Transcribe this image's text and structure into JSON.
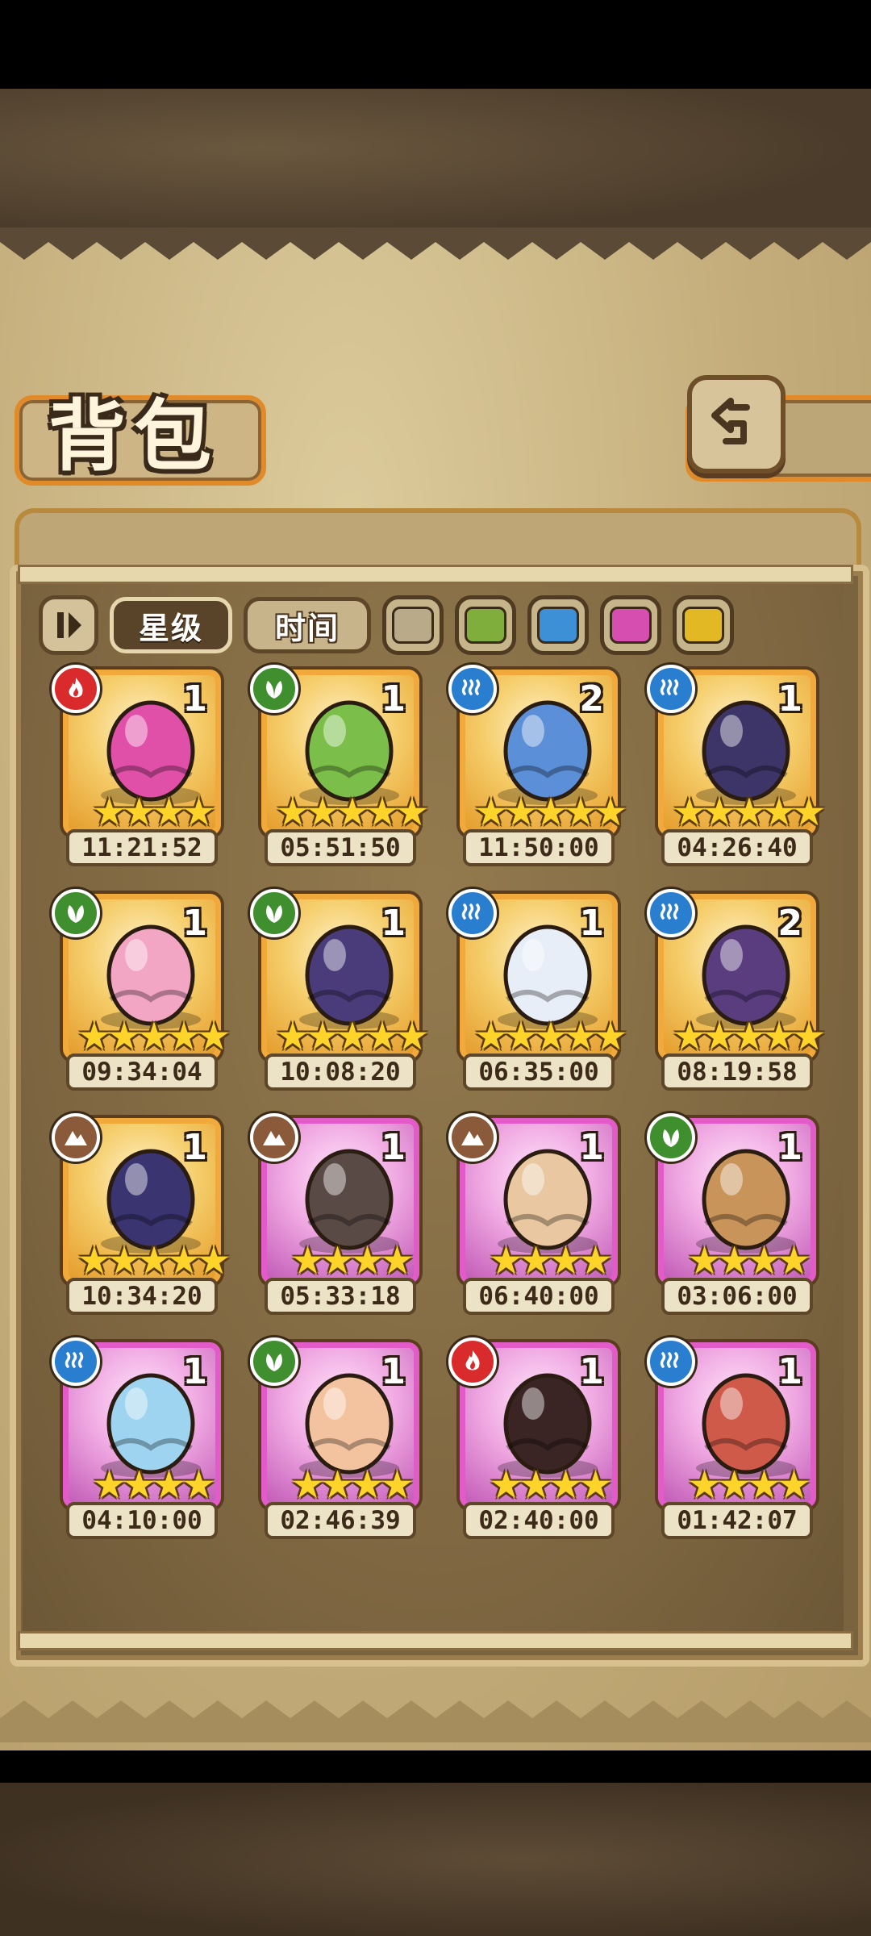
{
  "header": {
    "title": "背包"
  },
  "sort": {
    "star_label": "星级",
    "time_label": "时间"
  },
  "filters": [
    "#b9ab8a",
    "#7fae3c",
    "#3d8fd6",
    "#d64fb0",
    "#e2b825"
  ],
  "element_colors": {
    "fire": "#d92b2b",
    "grass": "#3f8f2e",
    "water": "#2a7ed0",
    "earth": "#8a5a3a"
  },
  "items": [
    {
      "name": "pink-vortex-egg",
      "element": "fire",
      "count": "1",
      "stars": 4,
      "rarity": "gold",
      "timer": "11:21:52",
      "art": "#e04fa8"
    },
    {
      "name": "green-lantern-egg",
      "element": "grass",
      "count": "1",
      "stars": 5,
      "rarity": "gold",
      "timer": "05:51:50",
      "art": "#7bbf4a"
    },
    {
      "name": "blue-shark-egg",
      "element": "water",
      "count": "2",
      "stars": 5,
      "rarity": "gold",
      "timer": "11:50:00",
      "art": "#5b8fd8"
    },
    {
      "name": "dark-feather-egg",
      "element": "water",
      "count": "1",
      "stars": 5,
      "rarity": "gold",
      "timer": "04:26:40",
      "art": "#3d3568"
    },
    {
      "name": "pink-fox-egg",
      "element": "grass",
      "count": "1",
      "stars": 5,
      "rarity": "gold",
      "timer": "09:34:04",
      "art": "#f3a6c4"
    },
    {
      "name": "purple-rune-egg",
      "element": "grass",
      "count": "1",
      "stars": 5,
      "rarity": "gold",
      "timer": "10:08:20",
      "art": "#4a3c7a"
    },
    {
      "name": "pearl-wing-egg",
      "element": "water",
      "count": "1",
      "stars": 5,
      "rarity": "gold",
      "timer": "06:35:00",
      "art": "#e8eef7"
    },
    {
      "name": "clock-egg",
      "element": "water",
      "count": "2",
      "stars": 5,
      "rarity": "gold",
      "timer": "08:19:58",
      "art": "#5a3d7e"
    },
    {
      "name": "crystal-rock-egg",
      "element": "earth",
      "count": "1",
      "stars": 5,
      "rarity": "gold",
      "timer": "10:34:20",
      "art": "#3a3470"
    },
    {
      "name": "bowtie-egg",
      "element": "earth",
      "count": "1",
      "stars": 4,
      "rarity": "purple",
      "timer": "05:33:18",
      "art": "#5a4a46"
    },
    {
      "name": "vine-nest-egg",
      "element": "earth",
      "count": "1",
      "stars": 4,
      "rarity": "purple",
      "timer": "06:40:00",
      "art": "#e9c7a0"
    },
    {
      "name": "tiger-egg",
      "element": "grass",
      "count": "1",
      "stars": 4,
      "rarity": "purple",
      "timer": "03:06:00",
      "art": "#c9945a"
    },
    {
      "name": "slime-cat-egg",
      "element": "water",
      "count": "1",
      "stars": 4,
      "rarity": "purple",
      "timer": "04:10:00",
      "art": "#9ed4ef"
    },
    {
      "name": "feather-nest-egg",
      "element": "grass",
      "count": "1",
      "stars": 4,
      "rarity": "purple",
      "timer": "02:46:39",
      "art": "#f3c3a0"
    },
    {
      "name": "lava-rock-egg",
      "element": "fire",
      "count": "1",
      "stars": 4,
      "rarity": "purple",
      "timer": "02:40:00",
      "art": "#3a2424"
    },
    {
      "name": "feather-headdress-egg",
      "element": "water",
      "count": "1",
      "stars": 4,
      "rarity": "purple",
      "timer": "01:42:07",
      "art": "#d05a4a"
    }
  ]
}
